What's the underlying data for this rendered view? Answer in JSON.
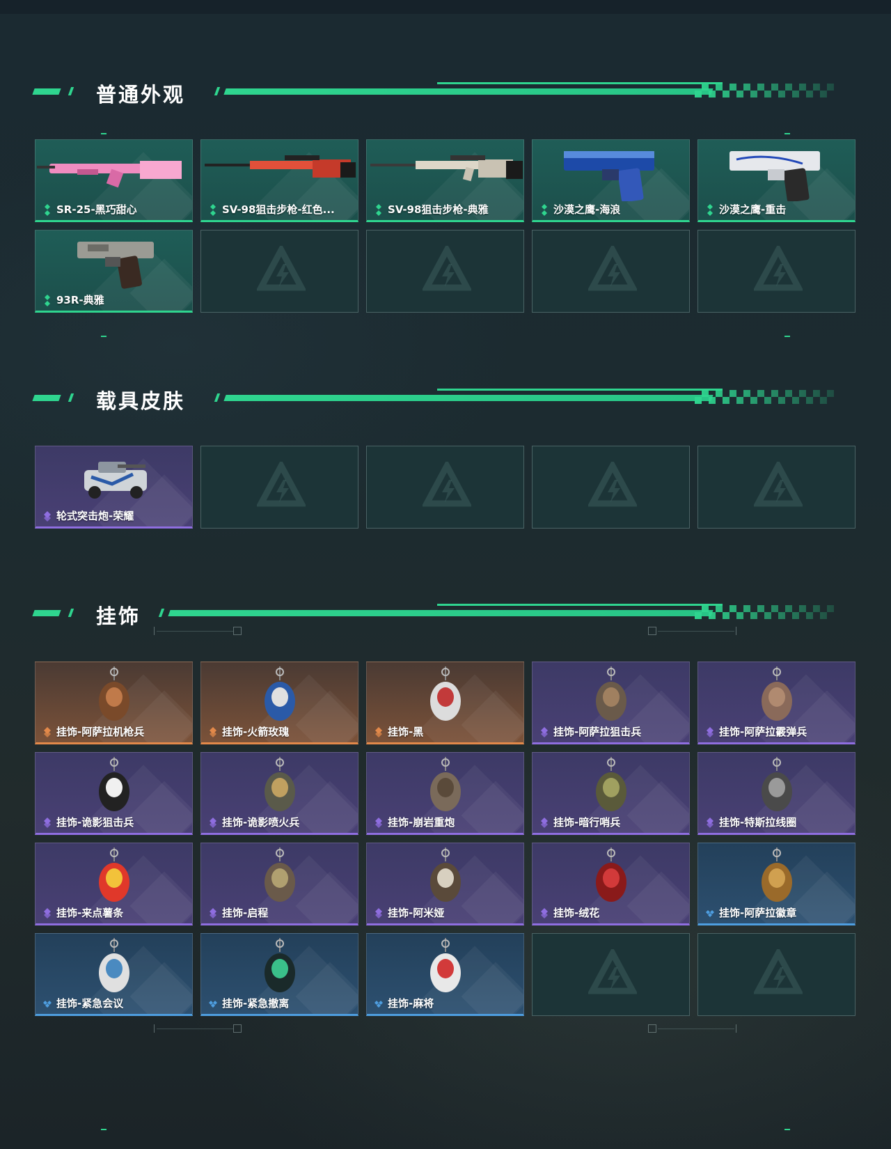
{
  "sections": [
    {
      "title": "普通外观",
      "items": [
        {
          "name": "SR-25-黑巧甜心",
          "rarity": "green",
          "icon": "pink-rifle"
        },
        {
          "name": "SV-98狙击步枪-红色...",
          "rarity": "green",
          "icon": "red-sniper-rifle"
        },
        {
          "name": "SV-98狙击步枪-典雅",
          "rarity": "green",
          "icon": "white-sniper-rifle"
        },
        {
          "name": "沙漠之鹰-海浪",
          "rarity": "green",
          "icon": "blue-pistol"
        },
        {
          "name": "沙漠之鹰-重击",
          "rarity": "green",
          "icon": "white-blue-pistol"
        },
        {
          "name": "93R-典雅",
          "rarity": "green",
          "icon": "camo-pistol"
        }
      ]
    },
    {
      "title": "载具皮肤",
      "items": [
        {
          "name": "轮式突击炮-荣耀",
          "rarity": "purple",
          "icon": "armored-vehicle"
        }
      ]
    },
    {
      "title": "挂饰",
      "items": [
        {
          "name": "挂饰-阿萨拉机枪兵",
          "rarity": "orange",
          "icon": "soldier-charm"
        },
        {
          "name": "挂饰-火箭玫瑰",
          "rarity": "orange",
          "icon": "rocket-charm"
        },
        {
          "name": "挂饰-黑",
          "rarity": "orange",
          "icon": "lighter-charm"
        },
        {
          "name": "挂饰-阿萨拉狙击兵",
          "rarity": "purple",
          "icon": "sniper-charm"
        },
        {
          "name": "挂饰-阿萨拉霰弹兵",
          "rarity": "purple",
          "icon": "shotgun-charm"
        },
        {
          "name": "挂饰-诡影狙击兵",
          "rarity": "purple",
          "icon": "penguin-charm"
        },
        {
          "name": "挂饰-诡影喷火兵",
          "rarity": "purple",
          "icon": "flamer-charm"
        },
        {
          "name": "挂饰-崩岩重炮",
          "rarity": "purple",
          "icon": "heavy-charm"
        },
        {
          "name": "挂饰-暗行哨兵",
          "rarity": "purple",
          "icon": "sentry-charm"
        },
        {
          "name": "挂饰-特斯拉线圈",
          "rarity": "purple",
          "icon": "tesla-coil-charm"
        },
        {
          "name": "挂饰-来点薯条",
          "rarity": "purple",
          "icon": "fries-charm"
        },
        {
          "name": "挂饰-启程",
          "rarity": "purple",
          "icon": "ring-charm"
        },
        {
          "name": "挂饰-阿米娅",
          "rarity": "purple",
          "icon": "bunny-charm"
        },
        {
          "name": "挂饰-绒花",
          "rarity": "purple",
          "icon": "flower-charm"
        },
        {
          "name": "挂饰-阿萨拉徽章",
          "rarity": "blue",
          "icon": "badge-charm"
        },
        {
          "name": "挂饰-紧急会议",
          "rarity": "blue",
          "icon": "meeting-charm"
        },
        {
          "name": "挂饰-紧急撤离",
          "rarity": "blue",
          "icon": "evac-charm"
        },
        {
          "name": "挂饰-麻将",
          "rarity": "blue",
          "icon": "mahjong-charm"
        }
      ]
    }
  ],
  "colors": {
    "accent": "#2fd58f",
    "green": "#2fd58f",
    "purple": "#8f6ee0",
    "orange": "#e3894a",
    "blue": "#4e9ee0"
  }
}
